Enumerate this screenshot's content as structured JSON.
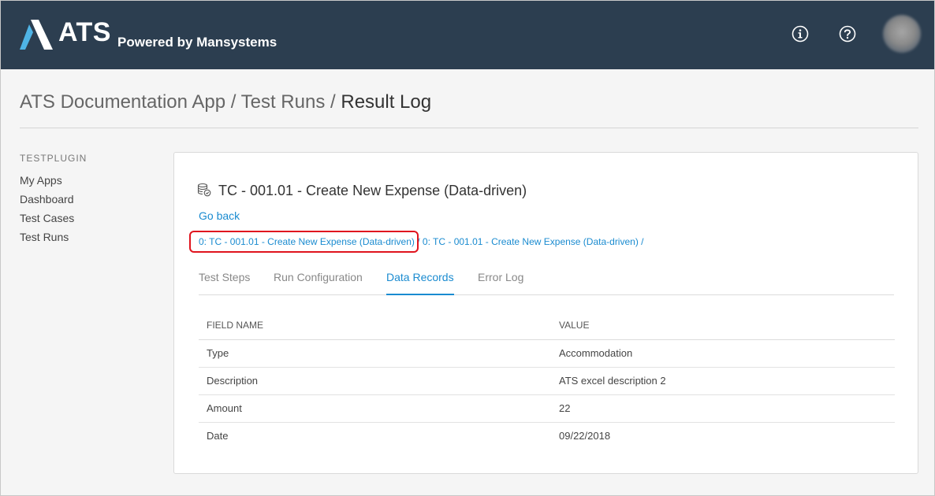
{
  "header": {
    "logo_text": "ATS",
    "logo_subtitle": "Powered by Mansystems",
    "bg_color": "#2c3e50",
    "icons": [
      "info-icon",
      "help-icon",
      "avatar"
    ]
  },
  "breadcrumb": {
    "part1": "ATS Documentation App",
    "sep1": "/",
    "part2": "Test Runs",
    "sep2": "/",
    "current": "Result Log"
  },
  "sidebar": {
    "heading": "TESTPLUGIN",
    "items": [
      {
        "label": "My Apps"
      },
      {
        "label": "Dashboard"
      },
      {
        "label": "Test Cases"
      },
      {
        "label": "Test Runs"
      }
    ]
  },
  "card": {
    "title": "TC - 001.01 - Create New Expense (Data-driven)",
    "title_icon": "database-icon",
    "go_back": "Go back",
    "crumbs": {
      "first": "0: TC - 001.01 - Create New Expense (Data-driven)",
      "sep": " / ",
      "second": "0: TC - 001.01 - Create New Expense (Data-driven)",
      "trailing": " /"
    },
    "tabs": [
      {
        "label": "Test Steps"
      },
      {
        "label": "Run Configuration"
      },
      {
        "label": "Data Records",
        "active": true
      },
      {
        "label": "Error Log"
      }
    ],
    "table": {
      "headers": [
        "FIELD NAME",
        "VALUE"
      ],
      "rows": [
        [
          "Type",
          "Accommodation"
        ],
        [
          "Description",
          "ATS excel description 2"
        ],
        [
          "Amount",
          "22"
        ],
        [
          "Date",
          "09/22/2018"
        ]
      ]
    }
  },
  "colors": {
    "accent": "#1a8bd0",
    "highlight": "#e0141e"
  }
}
